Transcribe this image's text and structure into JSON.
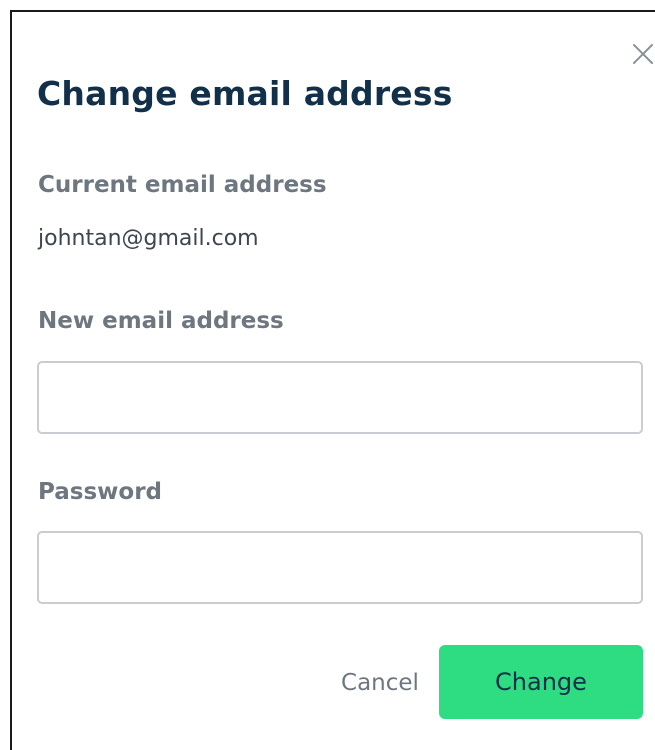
{
  "dialog": {
    "title": "Change email address",
    "close_icon": "close-icon",
    "current_email": {
      "label": "Current email address",
      "value": "johntan@gmail.com"
    },
    "new_email": {
      "label": "New email address",
      "value": "",
      "placeholder": ""
    },
    "password": {
      "label": "Password",
      "value": "",
      "placeholder": ""
    },
    "actions": {
      "cancel_label": "Cancel",
      "change_label": "Change"
    }
  },
  "colors": {
    "title": "#123049",
    "label": "#6e7780",
    "value": "#3d4650",
    "input_border": "#c9cdd2",
    "primary_button": "#2edc82",
    "frame_border": "#1a1a1a"
  }
}
